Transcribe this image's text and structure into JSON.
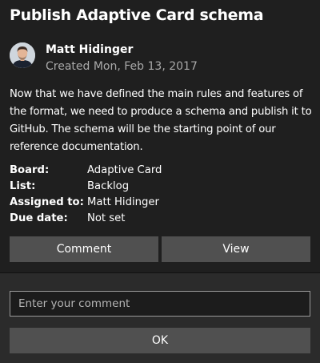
{
  "card": {
    "title": "Publish Adaptive Card schema",
    "author": {
      "name": "Matt Hidinger",
      "created": "Created Mon, Feb 13, 2017"
    },
    "description": "Now that we have defined the main rules and features of the format, we need to produce a schema and publish it to GitHub. The schema will be the starting point of our reference documentation.",
    "facts": [
      {
        "title": "Board:",
        "value": "Adaptive Card"
      },
      {
        "title": "List:",
        "value": "Backlog"
      },
      {
        "title": "Assigned to:",
        "value": "Matt Hidinger"
      },
      {
        "title": "Due date:",
        "value": "Not set"
      }
    ],
    "actions": {
      "comment_label": "Comment",
      "view_label": "View"
    }
  },
  "comment_panel": {
    "input_placeholder": "Enter your comment",
    "input_value": "",
    "ok_label": "OK"
  },
  "colors": {
    "background": "#1f1f1f",
    "panel_background": "#2b2b2b",
    "button": "#505050",
    "subtle_text": "#a9a9a9"
  }
}
